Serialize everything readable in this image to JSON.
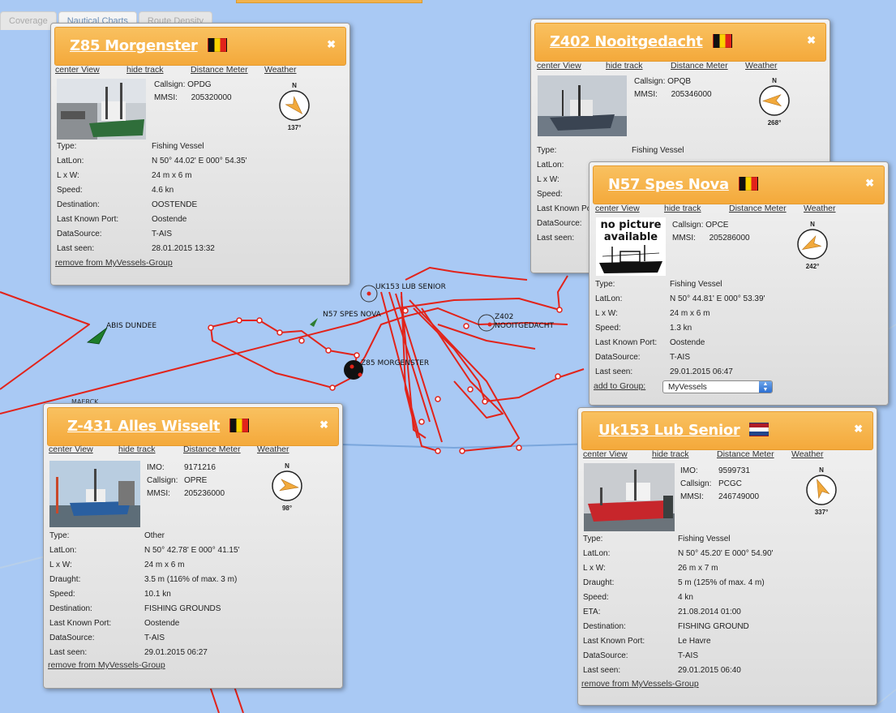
{
  "tabs": [
    {
      "label": "Coverage"
    },
    {
      "label": "Nautical Charts"
    },
    {
      "label": "Route Density"
    }
  ],
  "map": {
    "water_color": "#a9c9f4",
    "track_color": "#e2231a",
    "labels": {
      "abis_dundee": "ABIS DUNDEE",
      "uk153": "UK153 LUB SENIOR",
      "n57": "N57 SPES NOVA",
      "z402_line1": "Z402",
      "z402_line2": "NOOITGEDACHT",
      "z85": "Z85 MORGENSTER",
      "maerck": "MAERCK"
    }
  },
  "link_labels": {
    "center": "center View",
    "hide_track": "hide track",
    "distance": "Distance Meter",
    "weather": "Weather",
    "remove": "remove from MyVessels-Group",
    "add": "add to Group:"
  },
  "panels": {
    "z85": {
      "title": "Z85 Morgenster",
      "flag": "be",
      "fields": [
        {
          "k": "Callsign:",
          "v": "OPDG"
        },
        {
          "k": "MMSI:",
          "v": "205320000"
        }
      ],
      "heading": "137°",
      "heading_deg": 137,
      "rows": [
        {
          "k": "Type:",
          "v": "Fishing Vessel"
        },
        {
          "k": "LatLon:",
          "v": "N 50° 44.02' E 000° 54.35'"
        },
        {
          "k": "L x W:",
          "v": "24 m x 6 m"
        },
        {
          "k": "Speed:",
          "v": "4.6 kn"
        },
        {
          "k": "Destination:",
          "v": "OOSTENDE"
        },
        {
          "k": "Last Known Port:",
          "v": "Oostende"
        },
        {
          "k": "DataSource:",
          "v": "T-AIS"
        },
        {
          "k": "Last seen:",
          "v": "28.01.2015 13:32"
        }
      ]
    },
    "z402": {
      "title": "Z402 Nooitgedacht",
      "flag": "be",
      "fields": [
        {
          "k": "Callsign:",
          "v": "OPQB"
        },
        {
          "k": "MMSI:",
          "v": "205346000"
        }
      ],
      "heading": "268°",
      "heading_deg": 268,
      "rows": [
        {
          "k": "Type:",
          "v": "Fishing Vessel"
        },
        {
          "k": "LatLon:",
          "v": ""
        },
        {
          "k": "L x W:",
          "v": ""
        },
        {
          "k": "Speed:",
          "v": ""
        },
        {
          "k": "Last Known Port:",
          "v": ""
        },
        {
          "k": "DataSource:",
          "v": ""
        },
        {
          "k": "Last seen:",
          "v": ""
        }
      ]
    },
    "n57": {
      "title": "N57 Spes Nova",
      "flag": "be",
      "no_picture": "no picture available",
      "fields": [
        {
          "k": "Callsign:",
          "v": "OPCE"
        },
        {
          "k": "MMSI:",
          "v": "205286000"
        }
      ],
      "heading": "242°",
      "heading_deg": 242,
      "rows": [
        {
          "k": "Type:",
          "v": "Fishing Vessel"
        },
        {
          "k": "LatLon:",
          "v": "N 50° 44.81' E 000° 53.39'"
        },
        {
          "k": "L x W:",
          "v": "24 m x 6 m"
        },
        {
          "k": "Speed:",
          "v": "1.3 kn"
        },
        {
          "k": "Last Known Port:",
          "v": "Oostende"
        },
        {
          "k": "DataSource:",
          "v": "T-AIS"
        },
        {
          "k": "Last seen:",
          "v": "29.01.2015 06:47"
        }
      ],
      "group_value": "MyVessels"
    },
    "z431": {
      "title": "Z-431 Alles Wisselt",
      "flag": "be",
      "fields": [
        {
          "k": "IMO:",
          "v": "9171216"
        },
        {
          "k": "Callsign:",
          "v": "OPRE"
        },
        {
          "k": "MMSI:",
          "v": "205236000"
        }
      ],
      "heading": "98°",
      "heading_deg": 98,
      "rows": [
        {
          "k": "Type:",
          "v": "Other"
        },
        {
          "k": "LatLon:",
          "v": "N 50° 42.78' E 000° 41.15'"
        },
        {
          "k": "L x W:",
          "v": "24 m x 6 m"
        },
        {
          "k": "Draught:",
          "v": "3.5 m (116% of max. 3 m)"
        },
        {
          "k": "Speed:",
          "v": "10.1 kn"
        },
        {
          "k": "Destination:",
          "v": "FISHING GROUNDS"
        },
        {
          "k": "Last Known Port:",
          "v": "Oostende"
        },
        {
          "k": "DataSource:",
          "v": "T-AIS"
        },
        {
          "k": "Last seen:",
          "v": "29.01.2015 06:27"
        }
      ]
    },
    "uk153": {
      "title": "Uk153 Lub Senior",
      "flag": "nl",
      "fields": [
        {
          "k": "IMO:",
          "v": "9599731"
        },
        {
          "k": "Callsign:",
          "v": "PCGC"
        },
        {
          "k": "MMSI:",
          "v": "246749000"
        }
      ],
      "heading": "337°",
      "heading_deg": 337,
      "rows": [
        {
          "k": "Type:",
          "v": "Fishing Vessel"
        },
        {
          "k": "LatLon:",
          "v": "N 50° 45.20' E 000° 54.90'"
        },
        {
          "k": "L x W:",
          "v": "26 m x 7 m"
        },
        {
          "k": "Draught:",
          "v": "5 m (125% of max. 4 m)"
        },
        {
          "k": "Speed:",
          "v": "4 kn"
        },
        {
          "k": "ETA:",
          "v": "21.08.2014 01:00"
        },
        {
          "k": "Destination:",
          "v": "FISHING GROUND"
        },
        {
          "k": "Last Known Port:",
          "v": "Le Havre"
        },
        {
          "k": "DataSource:",
          "v": "T-AIS"
        },
        {
          "k": "Last seen:",
          "v": "29.01.2015 06:40"
        }
      ]
    }
  }
}
